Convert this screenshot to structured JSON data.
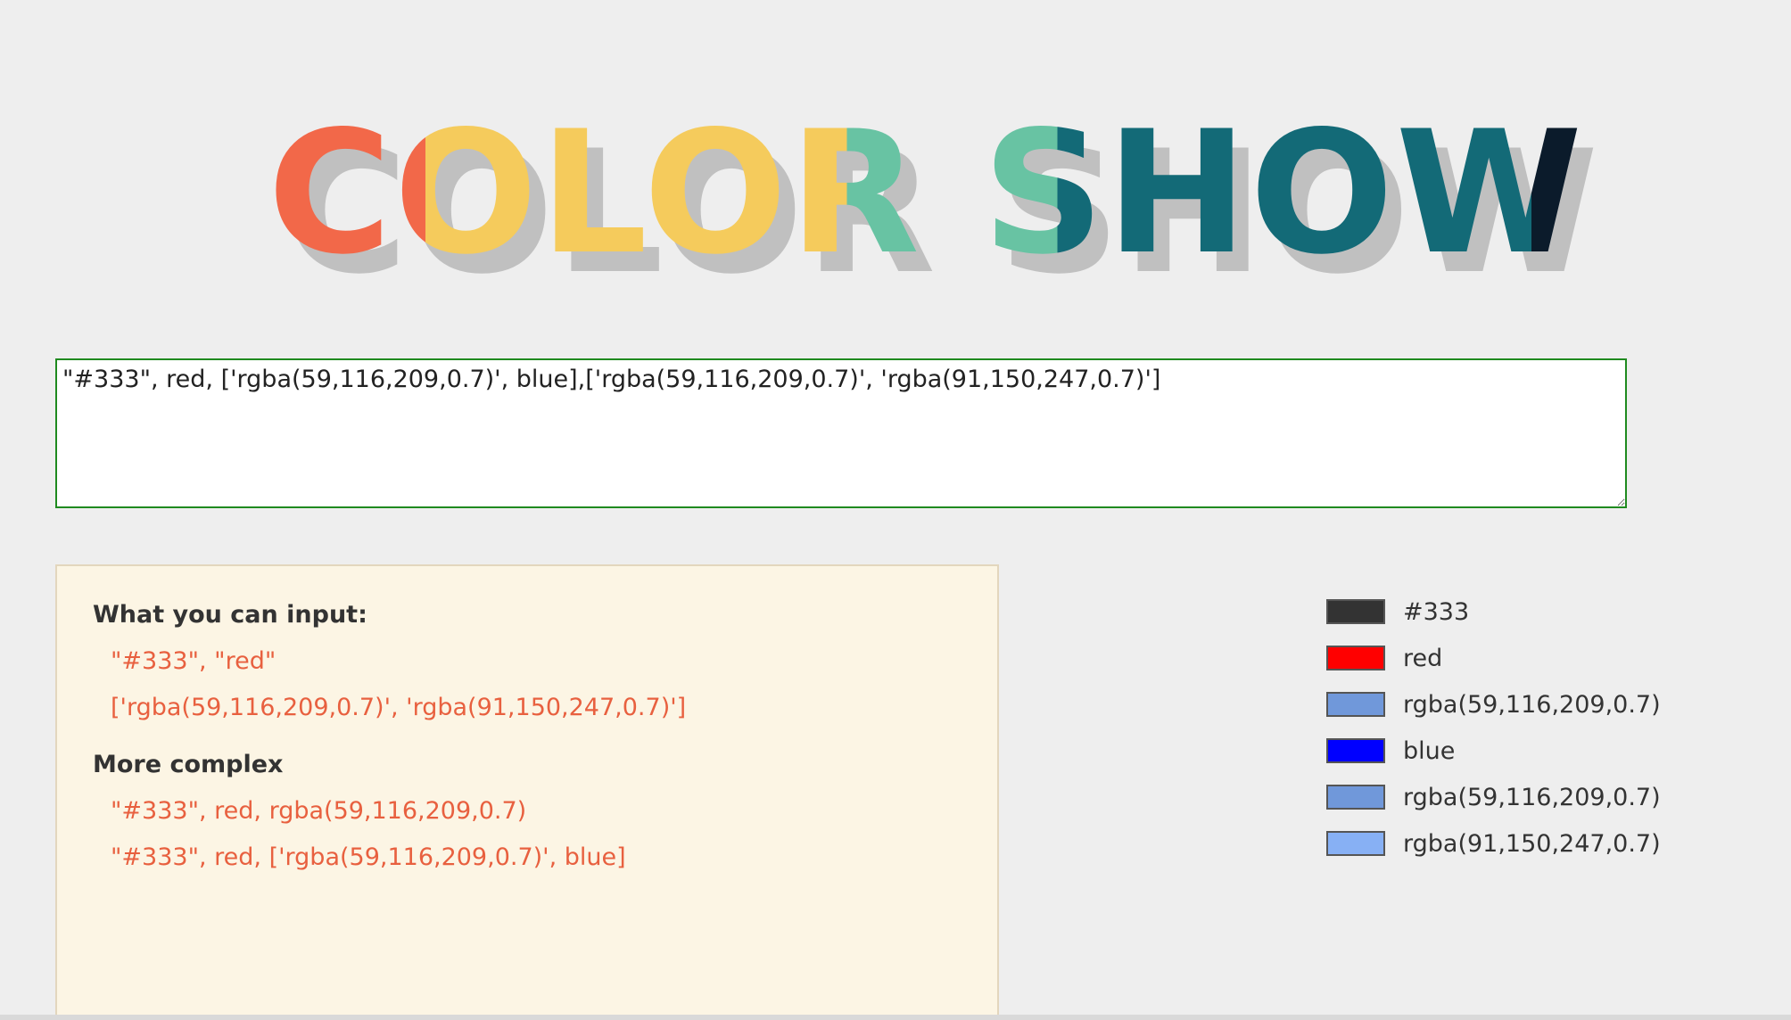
{
  "title": {
    "text": "COLOR SHOW",
    "colors": [
      "#f26849",
      "#f5cb5c",
      "#68c3a3",
      "#136a77",
      "#0b1b2b"
    ],
    "shadow_color": "#c0c0c0"
  },
  "input": {
    "value": "\"#333\", red, ['rgba(59,116,209,0.7)', blue],['rgba(59,116,209,0.7)', 'rgba(91,150,247,0.7)']"
  },
  "help": {
    "heading_1": "What you can input:",
    "examples_1": [
      "\"#333\", \"red\"",
      "['rgba(59,116,209,0.7)', 'rgba(91,150,247,0.7)']"
    ],
    "heading_2": "More complex",
    "examples_2": [
      "\"#333\", red, rgba(59,116,209,0.7)",
      "\"#333\", red, ['rgba(59,116,209,0.7)', blue]"
    ]
  },
  "swatches": [
    {
      "label": "#333",
      "color": "#333333"
    },
    {
      "label": "red",
      "color": "#ff0000"
    },
    {
      "label": "rgba(59,116,209,0.7)",
      "color": "rgba(59,116,209,0.7)"
    },
    {
      "label": "blue",
      "color": "#0000ff"
    },
    {
      "label": "rgba(59,116,209,0.7)",
      "color": "rgba(59,116,209,0.7)"
    },
    {
      "label": "rgba(91,150,247,0.7)",
      "color": "rgba(91,150,247,0.7)"
    }
  ]
}
